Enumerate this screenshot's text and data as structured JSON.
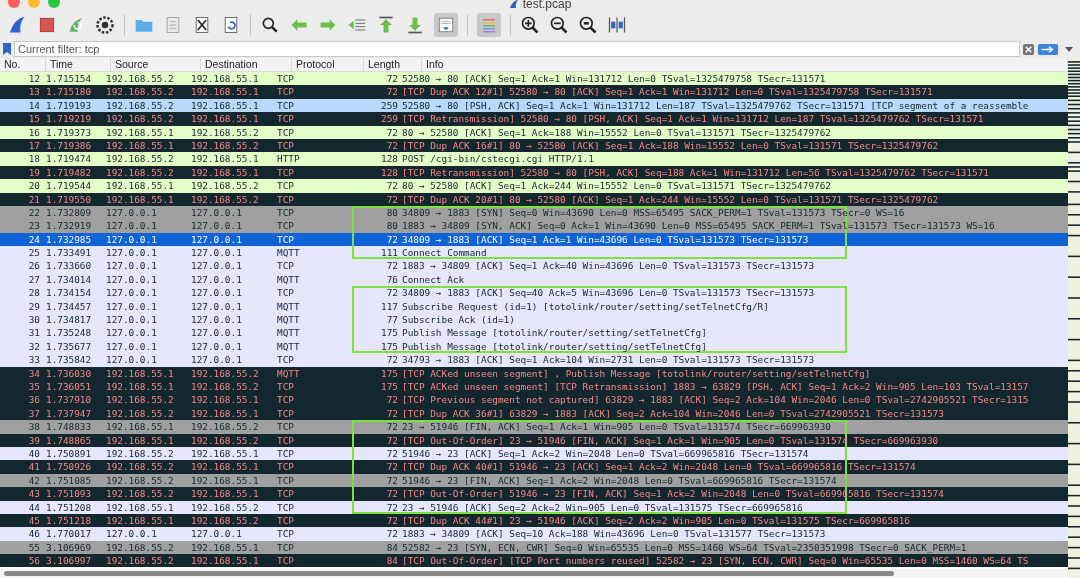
{
  "window": {
    "title": "test.pcap"
  },
  "filter": {
    "placeholder": "Current filter: tcp"
  },
  "columns": [
    "No.",
    "Time",
    "Source",
    "Destination",
    "Protocol",
    "Length",
    "Info"
  ],
  "packets": [
    {
      "no": "12",
      "time": "1.715154",
      "src": "192.168.55.2",
      "dst": "192.168.55.1",
      "proto": "TCP",
      "len": "72",
      "info": "52580 → 80 [ACK] Seq=1 Ack=1 Win=131712 Len=0 TSval=1325479758 TSecr=131571",
      "kind": "green",
      "selected": false,
      "boxed": false
    },
    {
      "no": "13",
      "time": "1.715180",
      "src": "192.168.55.2",
      "dst": "192.168.55.1",
      "proto": "TCP",
      "len": "72",
      "info": "[TCP Dup ACK 12#1] 52580 → 80 [ACK] Seq=1 Ack=1 Win=131712 Len=0 TSval=1325479758 TSecr=131571",
      "kind": "bad",
      "selected": false,
      "boxed": false
    },
    {
      "no": "14",
      "time": "1.719193",
      "src": "192.168.55.2",
      "dst": "192.168.55.1",
      "proto": "TCP",
      "len": "259",
      "info": "52580 → 80 [PSH, ACK] Seq=1 Ack=1 Win=131712 Len=187 TSval=1325479762 TSecr=131571 [TCP segment of a reassemble",
      "kind": "blue",
      "selected": false,
      "boxed": false
    },
    {
      "no": "15",
      "time": "1.719219",
      "src": "192.168.55.2",
      "dst": "192.168.55.1",
      "proto": "TCP",
      "len": "259",
      "info": "[TCP Retransmission] 52580 → 80 [PSH, ACK] Seq=1 Ack=1 Win=131712 Len=187 TSval=1325479762 TSecr=131571",
      "kind": "bad",
      "selected": false,
      "boxed": false
    },
    {
      "no": "16",
      "time": "1.719373",
      "src": "192.168.55.1",
      "dst": "192.168.55.2",
      "proto": "TCP",
      "len": "72",
      "info": "80 → 52580 [ACK] Seq=1 Ack=188 Win=15552 Len=0 TSval=131571 TSecr=1325479762",
      "kind": "green",
      "selected": false,
      "boxed": false
    },
    {
      "no": "17",
      "time": "1.719386",
      "src": "192.168.55.1",
      "dst": "192.168.55.2",
      "proto": "TCP",
      "len": "72",
      "info": "[TCP Dup ACK 16#1] 80 → 52580 [ACK] Seq=1 Ack=188 Win=15552 Len=0 TSval=131571 TSecr=1325479762",
      "kind": "bad",
      "selected": false,
      "boxed": false
    },
    {
      "no": "18",
      "time": "1.719474",
      "src": "192.168.55.2",
      "dst": "192.168.55.1",
      "proto": "HTTP",
      "len": "128",
      "info": "POST /cgi-bin/cstecgi.cgi HTTP/1.1",
      "kind": "green",
      "selected": false,
      "boxed": false
    },
    {
      "no": "19",
      "time": "1.719482",
      "src": "192.168.55.2",
      "dst": "192.168.55.1",
      "proto": "TCP",
      "len": "128",
      "info": "[TCP Retransmission] 52580 → 80 [PSH, ACK] Seq=188 Ack=1 Win=131712 Len=56 TSval=1325479762 TSecr=131571",
      "kind": "bad",
      "selected": false,
      "boxed": false
    },
    {
      "no": "20",
      "time": "1.719544",
      "src": "192.168.55.1",
      "dst": "192.168.55.2",
      "proto": "TCP",
      "len": "72",
      "info": "80 → 52580 [ACK] Seq=1 Ack=244 Win=15552 Len=0 TSval=131571 TSecr=1325479762",
      "kind": "green",
      "selected": false,
      "boxed": false
    },
    {
      "no": "21",
      "time": "1.719550",
      "src": "192.168.55.1",
      "dst": "192.168.55.2",
      "proto": "TCP",
      "len": "72",
      "info": "[TCP Dup ACK 20#1] 80 → 52580 [ACK] Seq=1 Ack=244 Win=15552 Len=0 TSval=131571 TSecr=1325479762",
      "kind": "bad",
      "selected": false,
      "boxed": false
    },
    {
      "no": "22",
      "time": "1.732809",
      "src": "127.0.0.1",
      "dst": "127.0.0.1",
      "proto": "TCP",
      "len": "80",
      "info": "34809 → 1883 [SYN] Seq=0 Win=43690 Len=0 MSS=65495 SACK_PERM=1 TSval=131573 TSecr=0 WS=16",
      "kind": "gray",
      "selected": false,
      "boxed": true
    },
    {
      "no": "23",
      "time": "1.732919",
      "src": "127.0.0.1",
      "dst": "127.0.0.1",
      "proto": "TCP",
      "len": "80",
      "info": "1883 → 34809 [SYN, ACK] Seq=0 Ack=1 Win=43690 Len=0 MSS=65495 SACK_PERM=1 TSval=131573 TSecr=131573 WS=16",
      "kind": "gray",
      "selected": false,
      "boxed": true
    },
    {
      "no": "24",
      "time": "1.732985",
      "src": "127.0.0.1",
      "dst": "127.0.0.1",
      "proto": "TCP",
      "len": "72",
      "info": "34809 → 1883 [ACK] Seq=1 Ack=1 Win=43696 Len=0 TSval=131573 TSecr=131573",
      "kind": "lavender",
      "selected": true,
      "boxed": true
    },
    {
      "no": "25",
      "time": "1.733491",
      "src": "127.0.0.1",
      "dst": "127.0.0.1",
      "proto": "MQTT",
      "len": "111",
      "info": "Connect Command",
      "kind": "lavender",
      "selected": false,
      "boxed": true
    },
    {
      "no": "26",
      "time": "1.733660",
      "src": "127.0.0.1",
      "dst": "127.0.0.1",
      "proto": "TCP",
      "len": "72",
      "info": "1883 → 34809 [ACK] Seq=1 Ack=40 Win=43696 Len=0 TSval=131573 TSecr=131573",
      "kind": "lavender",
      "selected": false,
      "boxed": false
    },
    {
      "no": "27",
      "time": "1.734014",
      "src": "127.0.0.1",
      "dst": "127.0.0.1",
      "proto": "MQTT",
      "len": "76",
      "info": "Connect Ack",
      "kind": "lavender",
      "selected": false,
      "boxed": false
    },
    {
      "no": "28",
      "time": "1.734154",
      "src": "127.0.0.1",
      "dst": "127.0.0.1",
      "proto": "TCP",
      "len": "72",
      "info": "34809 → 1883 [ACK] Seq=40 Ack=5 Win=43696 Len=0 TSval=131573 TSecr=131573",
      "kind": "lavender",
      "selected": false,
      "boxed": true
    },
    {
      "no": "29",
      "time": "1.734457",
      "src": "127.0.0.1",
      "dst": "127.0.0.1",
      "proto": "MQTT",
      "len": "117",
      "info": "Subscribe Request (id=1) [totolink/router/setting/setTelnetCfg/R]",
      "kind": "lavender",
      "selected": false,
      "boxed": true
    },
    {
      "no": "30",
      "time": "1.734817",
      "src": "127.0.0.1",
      "dst": "127.0.0.1",
      "proto": "MQTT",
      "len": "77",
      "info": "Subscribe Ack (id=1)",
      "kind": "lavender",
      "selected": false,
      "boxed": true
    },
    {
      "no": "31",
      "time": "1.735248",
      "src": "127.0.0.1",
      "dst": "127.0.0.1",
      "proto": "MQTT",
      "len": "175",
      "info": "Publish Message [totolink/router/setting/setTelnetCfg]",
      "kind": "lavender",
      "selected": false,
      "boxed": true
    },
    {
      "no": "32",
      "time": "1.735677",
      "src": "127.0.0.1",
      "dst": "127.0.0.1",
      "proto": "MQTT",
      "len": "175",
      "info": "Publish Message [totolink/router/setting/setTelnetCfg]",
      "kind": "lavender",
      "selected": false,
      "boxed": true
    },
    {
      "no": "33",
      "time": "1.735842",
      "src": "127.0.0.1",
      "dst": "127.0.0.1",
      "proto": "TCP",
      "len": "72",
      "info": "34793 → 1883 [ACK] Seq=1 Ack=104 Win=2731 Len=0 TSval=131573 TSecr=131573",
      "kind": "lavender",
      "selected": false,
      "boxed": false
    },
    {
      "no": "34",
      "time": "1.736030",
      "src": "192.168.55.1",
      "dst": "192.168.55.2",
      "proto": "MQTT",
      "len": "175",
      "info": "[TCP ACKed unseen segment] , Publish Message [totolink/router/setting/setTelnetCfg]",
      "kind": "bad",
      "selected": false,
      "boxed": false
    },
    {
      "no": "35",
      "time": "1.736051",
      "src": "192.168.55.1",
      "dst": "192.168.55.2",
      "proto": "TCP",
      "len": "175",
      "info": "[TCP ACKed unseen segment] [TCP Retransmission] 1883 → 63829 [PSH, ACK] Seq=1 Ack=2 Win=905 Len=103 TSval=13157",
      "kind": "bad",
      "selected": false,
      "boxed": false
    },
    {
      "no": "36",
      "time": "1.737910",
      "src": "192.168.55.2",
      "dst": "192.168.55.1",
      "proto": "TCP",
      "len": "72",
      "info": "[TCP Previous segment not captured] 63829 → 1883 [ACK] Seq=2 Ack=104 Win=2046 Len=0 TSval=2742905521 TSecr=1315",
      "kind": "bad",
      "selected": false,
      "boxed": false
    },
    {
      "no": "37",
      "time": "1.737947",
      "src": "192.168.55.2",
      "dst": "192.168.55.1",
      "proto": "TCP",
      "len": "72",
      "info": "[TCP Dup ACK 36#1] 63829 → 1883 [ACK] Seq=2 Ack=104 Win=2046 Len=0 TSval=2742905521 TSecr=131573",
      "kind": "bad",
      "selected": false,
      "boxed": false
    },
    {
      "no": "38",
      "time": "1.748833",
      "src": "192.168.55.1",
      "dst": "192.168.55.2",
      "proto": "TCP",
      "len": "72",
      "info": "23 → 51946 [FIN, ACK] Seq=1 Ack=1 Win=905 Len=0 TSval=131574 TSecr=669963930",
      "kind": "gray",
      "selected": false,
      "boxed": true
    },
    {
      "no": "39",
      "time": "1.748865",
      "src": "192.168.55.1",
      "dst": "192.168.55.2",
      "proto": "TCP",
      "len": "72",
      "info": "[TCP Out-Of-Order] 23 → 51946 [FIN, ACK] Seq=1 Ack=1 Win=905 Len=0 TSval=131574 TSecr=669963930",
      "kind": "bad",
      "selected": false,
      "boxed": true
    },
    {
      "no": "40",
      "time": "1.750891",
      "src": "192.168.55.2",
      "dst": "192.168.55.1",
      "proto": "TCP",
      "len": "72",
      "info": "51946 → 23 [ACK] Seq=1 Ack=2 Win=2048 Len=0 TSval=669965816 TSecr=131574",
      "kind": "lavender",
      "selected": false,
      "boxed": true
    },
    {
      "no": "41",
      "time": "1.750926",
      "src": "192.168.55.2",
      "dst": "192.168.55.1",
      "proto": "TCP",
      "len": "72",
      "info": "[TCP Dup ACK 40#1] 51946 → 23 [ACK] Seq=1 Ack=2 Win=2048 Len=0 TSval=669965816 TSecr=131574",
      "kind": "bad",
      "selected": false,
      "boxed": true
    },
    {
      "no": "42",
      "time": "1.751085",
      "src": "192.168.55.2",
      "dst": "192.168.55.1",
      "proto": "TCP",
      "len": "72",
      "info": "51946 → 23 [FIN, ACK] Seq=1 Ack=2 Win=2048 Len=0 TSval=669965816 TSecr=131574",
      "kind": "gray",
      "selected": false,
      "boxed": true
    },
    {
      "no": "43",
      "time": "1.751093",
      "src": "192.168.55.2",
      "dst": "192.168.55.1",
      "proto": "TCP",
      "len": "72",
      "info": "[TCP Out-Of-Order] 51946 → 23 [FIN, ACK] Seq=1 Ack=2 Win=2048 Len=0 TSval=669965816 TSecr=131574",
      "kind": "bad",
      "selected": false,
      "boxed": true
    },
    {
      "no": "44",
      "time": "1.751208",
      "src": "192.168.55.1",
      "dst": "192.168.55.2",
      "proto": "TCP",
      "len": "72",
      "info": "23 → 51946 [ACK] Seq=2 Ack=2 Win=905 Len=0 TSval=131575 TSecr=669965816",
      "kind": "lavender",
      "selected": false,
      "boxed": true
    },
    {
      "no": "45",
      "time": "1.751218",
      "src": "192.168.55.1",
      "dst": "192.168.55.2",
      "proto": "TCP",
      "len": "72",
      "info": "[TCP Dup ACK 44#1] 23 → 51946 [ACK] Seq=2 Ack=2 Win=905 Len=0 TSval=131575 TSecr=669965816",
      "kind": "bad",
      "selected": false,
      "boxed": false
    },
    {
      "no": "46",
      "time": "1.770017",
      "src": "127.0.0.1",
      "dst": "127.0.0.1",
      "proto": "TCP",
      "len": "72",
      "info": "1883 → 34809 [ACK] Seq=10 Ack=188 Win=43696 Len=0 TSval=131577 TSecr=131573",
      "kind": "lavender",
      "selected": false,
      "boxed": false
    },
    {
      "no": "55",
      "time": "3.106969",
      "src": "192.168.55.2",
      "dst": "192.168.55.1",
      "proto": "TCP",
      "len": "84",
      "info": "52582 → 23 [SYN, ECN, CWR] Seq=0 Win=65535 Len=0 MSS=1460 WS=64 TSval=2350351998 TSecr=0 SACK_PERM=1",
      "kind": "gray",
      "selected": false,
      "boxed": false
    },
    {
      "no": "56",
      "time": "3.106997",
      "src": "192.168.55.2",
      "dst": "192.168.55.1",
      "proto": "TCP",
      "len": "84",
      "info": "[TCP Out-Of-Order] [TCP Port numbers reused] 52582 → 23 [SYN, ECN, CWR] Seq=0 Win=65535 Len=0 MSS=1460 WS=64 TS",
      "kind": "bad",
      "selected": false,
      "boxed": false
    }
  ]
}
